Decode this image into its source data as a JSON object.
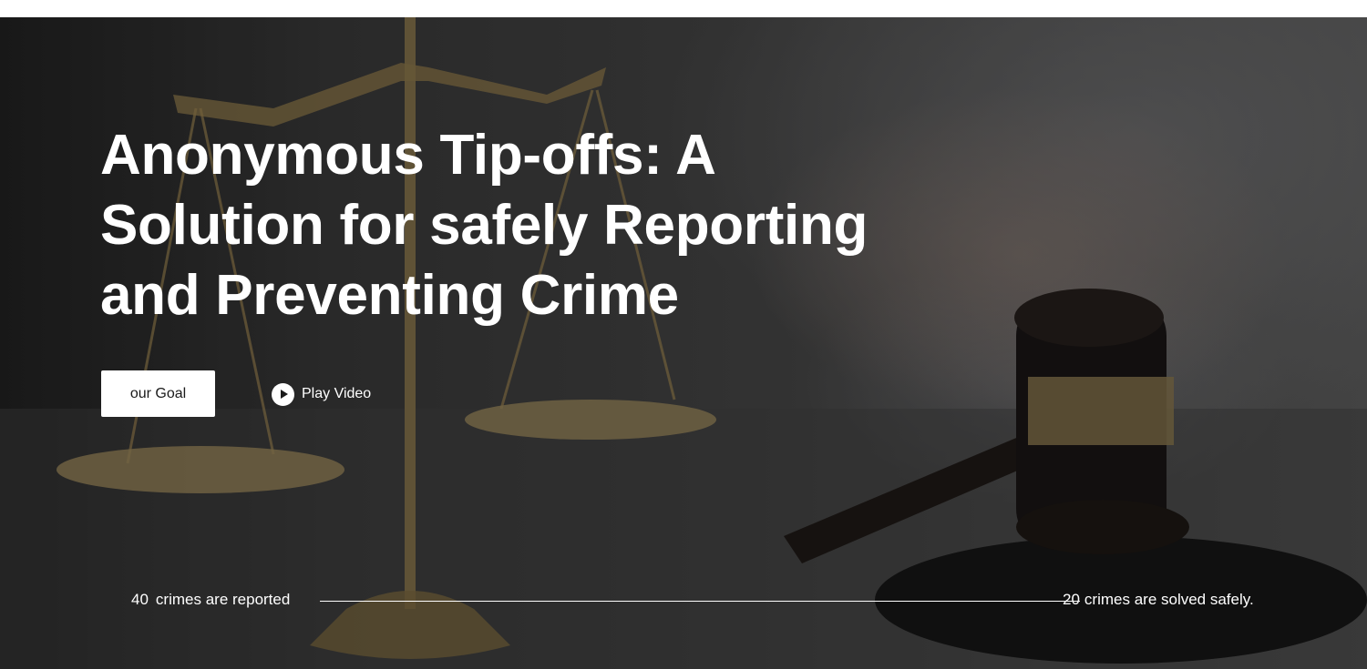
{
  "hero": {
    "title": "Anonymous Tip-offs: A Solution for safely Reporting and Preventing Crime",
    "primary_button": "our Goal",
    "video_button": "Play Video",
    "play_icon": "play-circle-icon"
  },
  "stats": {
    "reported": {
      "value": "40",
      "label": "crimes are reported"
    },
    "solved": {
      "value": "20",
      "label": "crimes are solved safely."
    }
  },
  "colors": {
    "text": "#ffffff",
    "button_bg": "#ffffff",
    "button_text": "#1a1a1a",
    "overlay": "#333333"
  }
}
